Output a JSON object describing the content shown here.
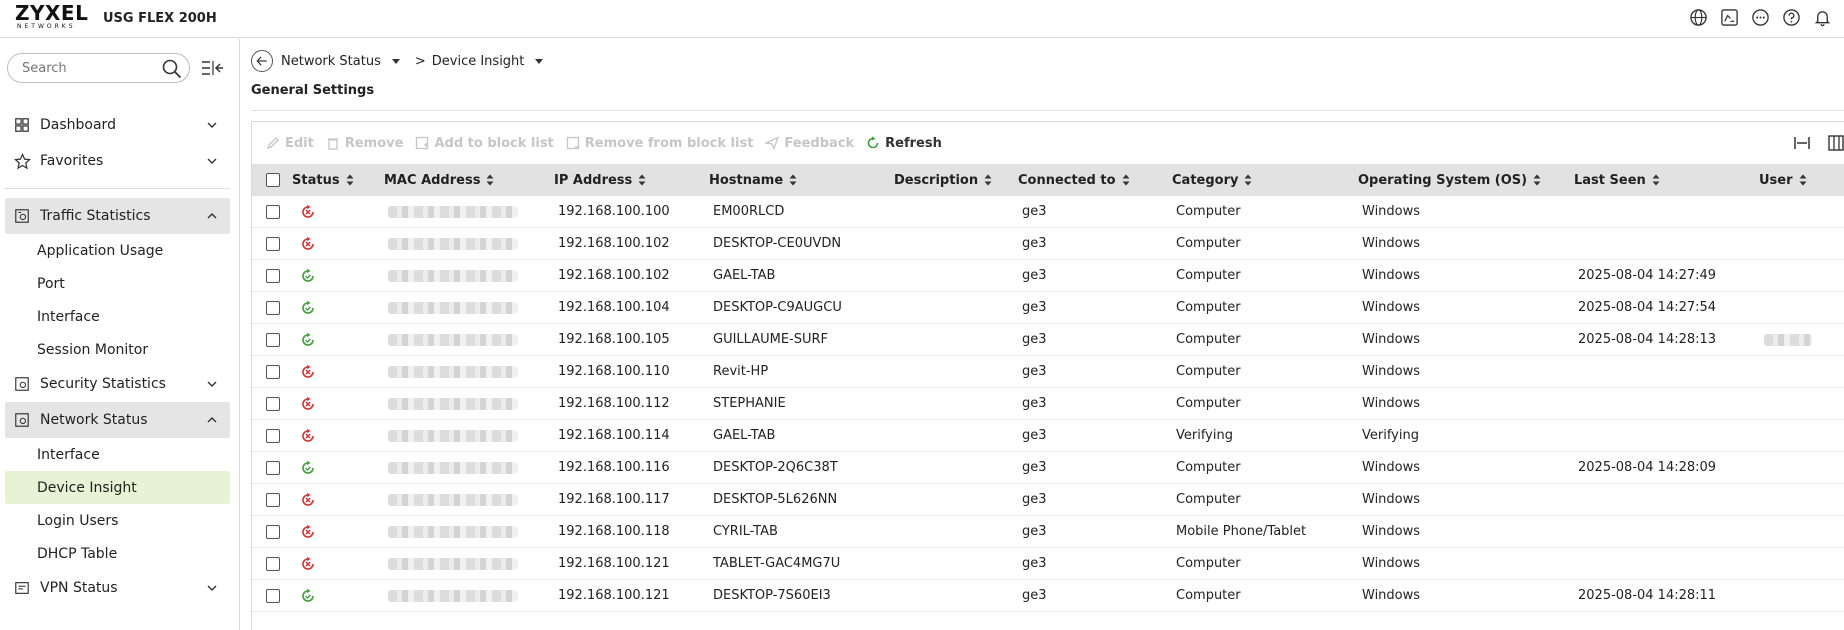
{
  "header": {
    "brand": "ZYXEL",
    "brand_sub": "NETWORKS",
    "model": "USG FLEX 200H",
    "icons": [
      "globe-icon",
      "cli-icon",
      "more-icon",
      "help-icon",
      "bell-icon"
    ]
  },
  "sidebar": {
    "search_placeholder": "Search",
    "top_items": [
      {
        "label": "Dashboard",
        "icon": "dashboard-icon"
      },
      {
        "label": "Favorites",
        "icon": "star-icon"
      }
    ],
    "traffic_statistics": {
      "label": "Traffic Statistics",
      "items": [
        "Application Usage",
        "Port",
        "Interface",
        "Session Monitor"
      ]
    },
    "security_statistics": {
      "label": "Security Statistics"
    },
    "network_status": {
      "label": "Network Status",
      "items": [
        "Interface",
        "Device Insight",
        "Login Users",
        "DHCP Table"
      ]
    },
    "vpn_status": {
      "label": "VPN Status"
    }
  },
  "breadcrumb": {
    "level1": "Network Status",
    "separator": ">",
    "level2": "Device Insight"
  },
  "page_title": "General Settings",
  "toolbar": {
    "edit": "Edit",
    "remove": "Remove",
    "add_block": "Add to block list",
    "remove_block": "Remove from block list",
    "feedback": "Feedback",
    "refresh": "Refresh"
  },
  "table": {
    "columns": {
      "status": "Status",
      "mac": "MAC Address",
      "ip": "IP Address",
      "hostname": "Hostname",
      "description": "Description",
      "connected": "Connected to",
      "category": "Category",
      "os": "Operating System (OS)",
      "last_seen": "Last Seen",
      "user": "User"
    },
    "rows": [
      {
        "status": "offline",
        "ip": "192.168.100.100",
        "hostname": "EM00RLCD",
        "connected": "ge3",
        "category": "Computer",
        "os": "Windows",
        "last_seen": "",
        "user_blur": false
      },
      {
        "status": "offline",
        "ip": "192.168.100.102",
        "hostname": "DESKTOP-CE0UVDN",
        "connected": "ge3",
        "category": "Computer",
        "os": "Windows",
        "last_seen": "",
        "user_blur": false
      },
      {
        "status": "online",
        "ip": "192.168.100.102",
        "hostname": "GAEL-TAB",
        "connected": "ge3",
        "category": "Computer",
        "os": "Windows",
        "last_seen": "2025-08-04 14:27:49",
        "user_blur": false
      },
      {
        "status": "online",
        "ip": "192.168.100.104",
        "hostname": "DESKTOP-C9AUGCU",
        "connected": "ge3",
        "category": "Computer",
        "os": "Windows",
        "last_seen": "2025-08-04 14:27:54",
        "user_blur": false
      },
      {
        "status": "online",
        "ip": "192.168.100.105",
        "hostname": "GUILLAUME-SURF",
        "connected": "ge3",
        "category": "Computer",
        "os": "Windows",
        "last_seen": "2025-08-04 14:28:13",
        "user_blur": true
      },
      {
        "status": "offline",
        "ip": "192.168.100.110",
        "hostname": "Revit-HP",
        "connected": "ge3",
        "category": "Computer",
        "os": "Windows",
        "last_seen": "",
        "user_blur": false
      },
      {
        "status": "offline",
        "ip": "192.168.100.112",
        "hostname": "STEPHANIE",
        "connected": "ge3",
        "category": "Computer",
        "os": "Windows",
        "last_seen": "",
        "user_blur": false
      },
      {
        "status": "offline",
        "ip": "192.168.100.114",
        "hostname": "GAEL-TAB",
        "connected": "ge3",
        "category": "Verifying",
        "os": "Verifying",
        "last_seen": "",
        "user_blur": false
      },
      {
        "status": "online",
        "ip": "192.168.100.116",
        "hostname": "DESKTOP-2Q6C38T",
        "connected": "ge3",
        "category": "Computer",
        "os": "Windows",
        "last_seen": "2025-08-04 14:28:09",
        "user_blur": false
      },
      {
        "status": "offline",
        "ip": "192.168.100.117",
        "hostname": "DESKTOP-5L626NN",
        "connected": "ge3",
        "category": "Computer",
        "os": "Windows",
        "last_seen": "",
        "user_blur": false
      },
      {
        "status": "offline",
        "ip": "192.168.100.118",
        "hostname": "CYRIL-TAB",
        "connected": "ge3",
        "category": "Mobile Phone/Tablet",
        "os": "Windows",
        "last_seen": "",
        "user_blur": false
      },
      {
        "status": "offline",
        "ip": "192.168.100.121",
        "hostname": "TABLET-GAC4MG7U",
        "connected": "ge3",
        "category": "Computer",
        "os": "Windows",
        "last_seen": "",
        "user_blur": false
      },
      {
        "status": "online",
        "ip": "192.168.100.121",
        "hostname": "DESKTOP-7S60EI3",
        "connected": "ge3",
        "category": "Computer",
        "os": "Windows",
        "last_seen": "2025-08-04 14:28:11",
        "user_blur": false
      }
    ]
  },
  "colors": {
    "online": "#3aa335",
    "offline": "#d9322b",
    "active_nav": "#e6f3d4",
    "group_nav": "#e5e5e5",
    "table_header": "#e2e2e2"
  }
}
